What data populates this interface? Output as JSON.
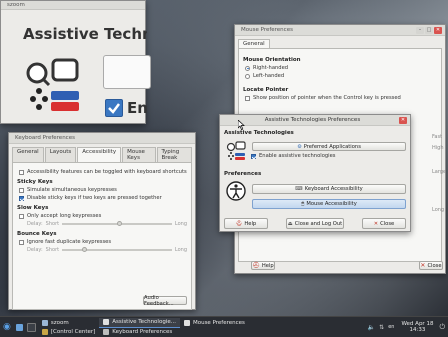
{
  "desktop": {},
  "mouse_prefs": {
    "title": "Mouse Preferences",
    "tabs": [
      "General"
    ],
    "orientation_heading": "Mouse Orientation",
    "right_handed": "Right-handed",
    "left_handed": "Left-handed",
    "locate_heading": "Locate Pointer",
    "locate_option": "Show position of pointer when the Control key is pressed",
    "side_labels": [
      "Fast",
      "High",
      "Large",
      "Long"
    ],
    "help_label": "Help",
    "close_label": "Close"
  },
  "zoom_win": {
    "title": "szoom",
    "heading": "Assistive Technol",
    "checkbox_text": "En"
  },
  "keyboard_prefs": {
    "title": "Keyboard Preferences",
    "tabs": [
      "General",
      "Layouts",
      "Accessibility",
      "Mouse Keys",
      "Typing Break"
    ],
    "active_tab": "Accessibility",
    "shortcut_option": "Accessibility features can be toggled with keyboard shortcuts",
    "sticky_heading": "Sticky Keys",
    "sticky_simulate": "Simulate simultaneous keypresses",
    "sticky_disable": "Disable sticky keys if two keys are pressed together",
    "slow_heading": "Slow Keys",
    "slow_only": "Only accept long keypresses",
    "delay_label": "Delay:",
    "short_label": "Short",
    "long_label": "Long",
    "bounce_heading": "Bounce Keys",
    "bounce_ignore": "Ignore fast duplicate keypresses",
    "audio_feedback": "Audio Feedback..."
  },
  "at_prefs": {
    "title": "Assistive Technologies Preferences",
    "at_heading": "Assistive Technologies",
    "preferred_apps": "Preferred Applications",
    "enable_at": "Enable assistive technologies",
    "prefs_heading": "Preferences",
    "keyboard_accessibility": "Keyboard Accessibility",
    "mouse_accessibility": "Mouse Accessibility",
    "help": "Help",
    "close_logout": "Close and Log Out",
    "close": "Close"
  },
  "taskbar": {
    "items": [
      {
        "label": "szoom"
      },
      {
        "label": "[Control Center]"
      },
      {
        "label": "Assistive Technologie..."
      },
      {
        "label": "Mouse Preferences"
      },
      {
        "label": "Keyboard Preferences"
      }
    ],
    "locale": "en",
    "date": "Wed Apr 18",
    "time": "14:33"
  }
}
